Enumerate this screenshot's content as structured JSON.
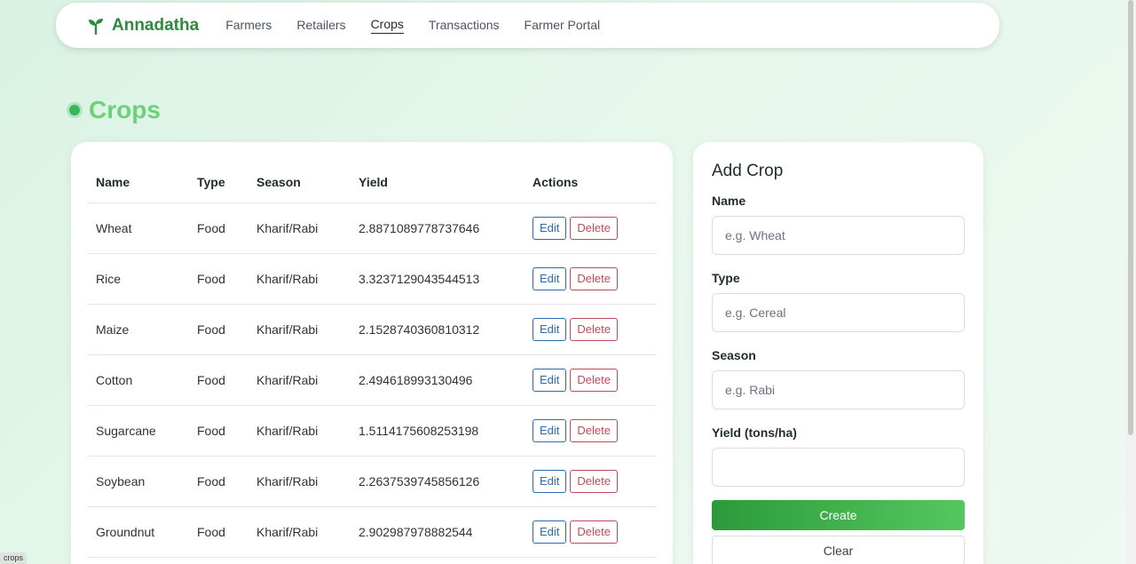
{
  "brand": {
    "name": "Annadatha",
    "icon": "sprout-icon",
    "color": "#2e8a3e"
  },
  "nav": {
    "links": [
      {
        "label": "Farmers",
        "active": false
      },
      {
        "label": "Retailers",
        "active": false
      },
      {
        "label": "Crops",
        "active": true
      },
      {
        "label": "Transactions",
        "active": false
      },
      {
        "label": "Farmer Portal",
        "active": false
      }
    ]
  },
  "page": {
    "title": "Crops"
  },
  "table": {
    "headers": [
      "Name",
      "Type",
      "Season",
      "Yield",
      "Actions"
    ],
    "edit_label": "Edit",
    "delete_label": "Delete",
    "rows": [
      {
        "name": "Wheat",
        "type": "Food",
        "season": "Kharif/Rabi",
        "yield": "2.8871089778737646"
      },
      {
        "name": "Rice",
        "type": "Food",
        "season": "Kharif/Rabi",
        "yield": "3.3237129043544513"
      },
      {
        "name": "Maize",
        "type": "Food",
        "season": "Kharif/Rabi",
        "yield": "2.1528740360810312"
      },
      {
        "name": "Cotton",
        "type": "Food",
        "season": "Kharif/Rabi",
        "yield": "2.494618993130496"
      },
      {
        "name": "Sugarcane",
        "type": "Food",
        "season": "Kharif/Rabi",
        "yield": "1.5114175608253198"
      },
      {
        "name": "Soybean",
        "type": "Food",
        "season": "Kharif/Rabi",
        "yield": "2.2637539745856126"
      },
      {
        "name": "Groundnut",
        "type": "Food",
        "season": "Kharif/Rabi",
        "yield": "2.902987978882544"
      }
    ]
  },
  "form": {
    "title": "Add Crop",
    "fields": [
      {
        "label": "Name",
        "placeholder": "e.g. Wheat",
        "value": ""
      },
      {
        "label": "Type",
        "placeholder": "e.g. Cereal",
        "value": ""
      },
      {
        "label": "Season",
        "placeholder": "e.g. Rabi",
        "value": ""
      },
      {
        "label": "Yield (tons/ha)",
        "placeholder": "",
        "value": ""
      }
    ],
    "create_label": "Create",
    "clear_label": "Clear"
  },
  "status": {
    "tip": "crops"
  },
  "colors": {
    "accent": "#35b85a",
    "heading": "#6fd07a",
    "edit": "#2b6cb0",
    "delete": "#c24b5a"
  }
}
